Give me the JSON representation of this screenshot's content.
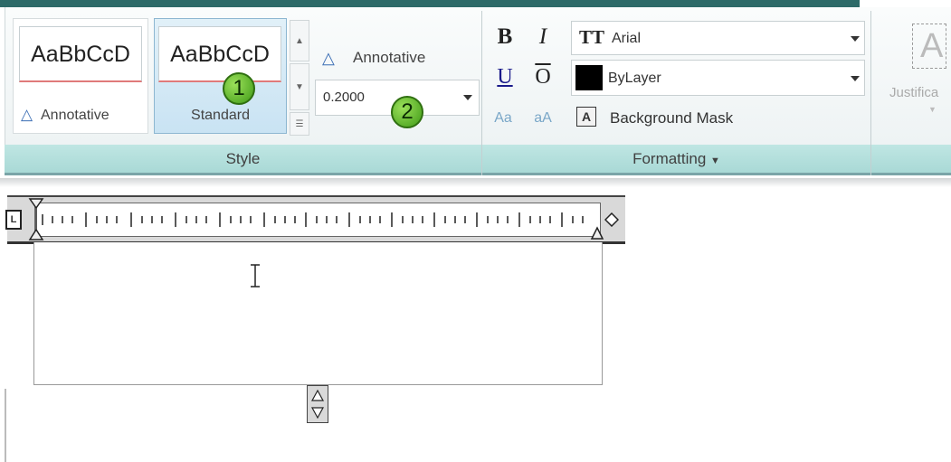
{
  "ribbon": {
    "style_panel": {
      "title": "Style",
      "gallery": [
        {
          "sample": "AaBbCcD",
          "label": "Annotative",
          "selected": false
        },
        {
          "sample": "AaBbCcD",
          "label": "Standard",
          "selected": true
        }
      ],
      "annotative_label": "Annotative",
      "text_height": "0.2000"
    },
    "formatting_panel": {
      "title": "Formatting",
      "bold": "B",
      "italic": "I",
      "underline": "U",
      "overline": "O",
      "uppercase": "aA",
      "lowercase": "Aa",
      "font": "Arial",
      "color": "ByLayer",
      "color_swatch": "#000000",
      "background_mask": "Background Mask"
    },
    "justification_label": "Justifica"
  },
  "callouts": [
    "1",
    "2"
  ],
  "editor": {
    "ruler_left_marker": "L"
  },
  "colors": {
    "callout_green": "#4fa71f",
    "panel_title_bar": "#b3dfdc",
    "selected_blue": "#cfe6f5"
  }
}
